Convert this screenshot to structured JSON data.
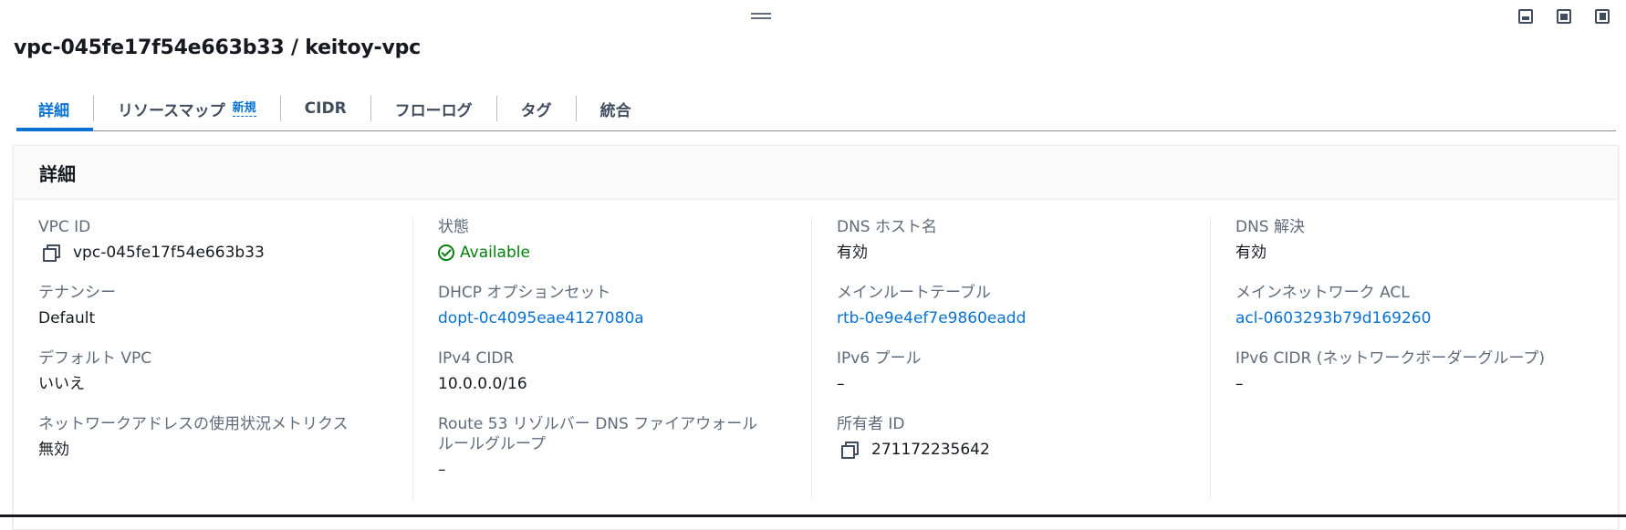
{
  "header": {
    "title": "vpc-045fe17f54e663b33 / keitoy-vpc"
  },
  "tabs": [
    {
      "label": "詳細",
      "active": true
    },
    {
      "label": "リソースマップ",
      "badge": "新規"
    },
    {
      "label": "CIDR"
    },
    {
      "label": "フローログ"
    },
    {
      "label": "タグ"
    },
    {
      "label": "統合"
    }
  ],
  "panel": {
    "title": "詳細",
    "col1": {
      "vpc_id": {
        "label": "VPC ID",
        "value": "vpc-045fe17f54e663b33"
      },
      "tenancy": {
        "label": "テナンシー",
        "value": "Default"
      },
      "default_vpc": {
        "label": "デフォルト VPC",
        "value": "いいえ"
      },
      "nau_metrics": {
        "label": "ネットワークアドレスの使用状況メトリクス",
        "value": "無効"
      }
    },
    "col2": {
      "state": {
        "label": "状態",
        "value": "Available"
      },
      "dhcp": {
        "label": "DHCP オプションセット",
        "value": "dopt-0c4095eae4127080a"
      },
      "ipv4_cidr": {
        "label": "IPv4 CIDR",
        "value": "10.0.0.0/16"
      },
      "route53": {
        "label": "Route 53 リゾルバー DNS ファイアウォールルールグループ",
        "value": "–"
      }
    },
    "col3": {
      "dns_hostnames": {
        "label": "DNS ホスト名",
        "value": "有効"
      },
      "main_route_table": {
        "label": "メインルートテーブル",
        "value": "rtb-0e9e4ef7e9860eadd"
      },
      "ipv6_pool": {
        "label": "IPv6 プール",
        "value": "–"
      },
      "owner_id": {
        "label": "所有者 ID",
        "value": "271172235642"
      }
    },
    "col4": {
      "dns_resolution": {
        "label": "DNS 解決",
        "value": "有効"
      },
      "main_acl": {
        "label": "メインネットワーク ACL",
        "value": "acl-0603293b79d169260"
      },
      "ipv6_cidr": {
        "label": "IPv6 CIDR (ネットワークボーダーグループ)",
        "value": "–"
      }
    }
  },
  "colors": {
    "accent": "#0972d3",
    "success": "#037f0c",
    "label": "#5f6b7a",
    "text": "#16191f"
  }
}
